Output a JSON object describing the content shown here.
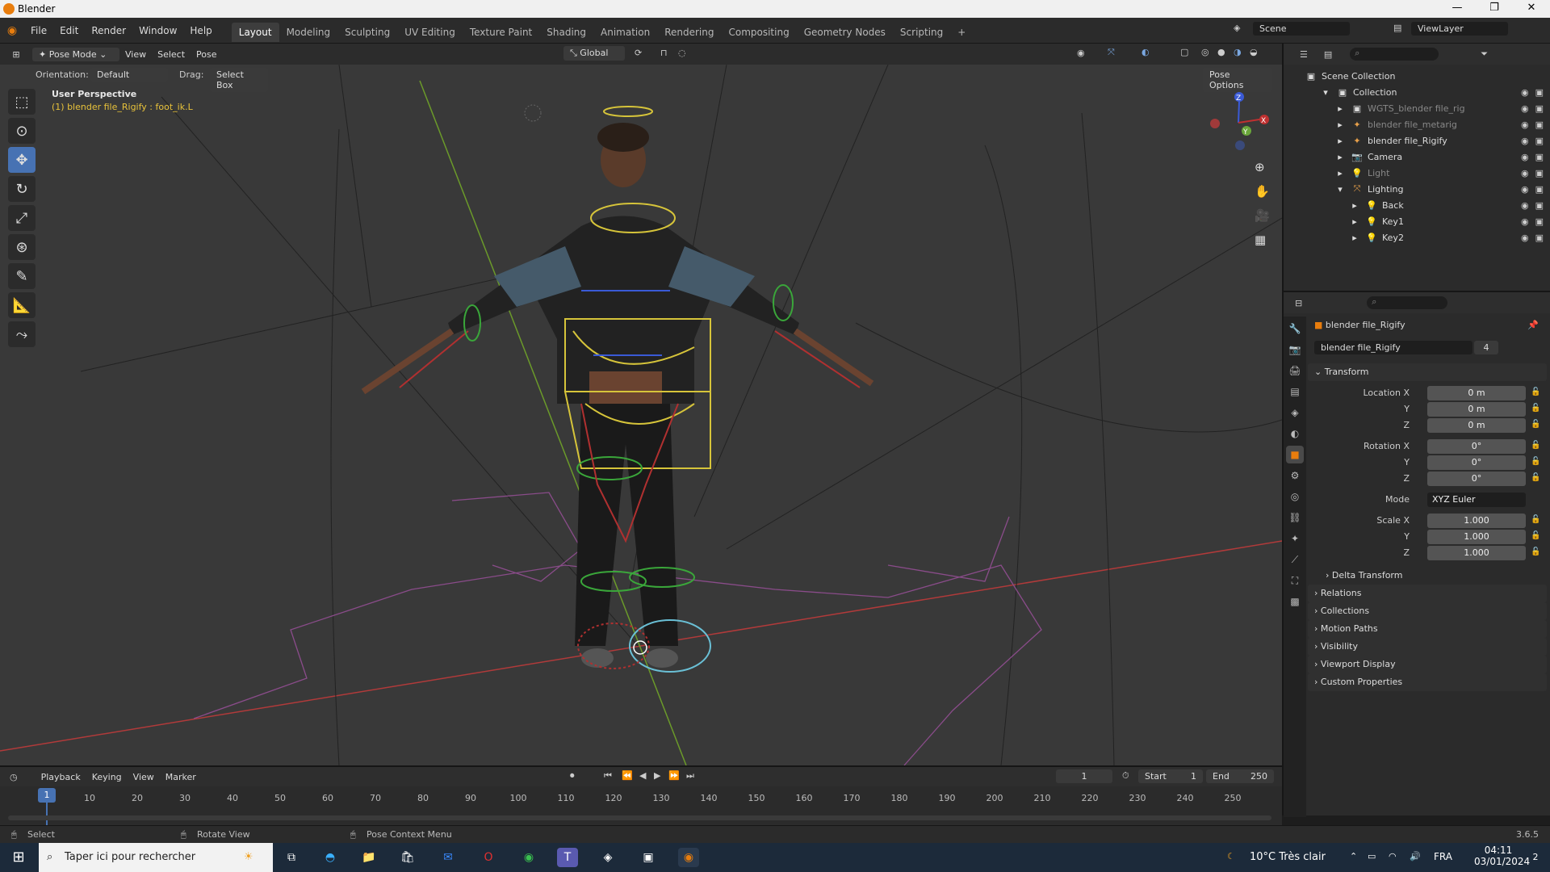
{
  "window": {
    "title": "Blender",
    "controls": [
      "—",
      "❐",
      "✕"
    ]
  },
  "menu": [
    "File",
    "Edit",
    "Render",
    "Window",
    "Help"
  ],
  "workspaces": [
    "Layout",
    "Modeling",
    "Sculpting",
    "UV Editing",
    "Texture Paint",
    "Shading",
    "Animation",
    "Rendering",
    "Compositing",
    "Geometry Nodes",
    "Scripting"
  ],
  "active_workspace": "Layout",
  "add_workspace": "+",
  "scene_name": "Scene",
  "view_layer": "ViewLayer",
  "viewport_header": {
    "mode": "Pose Mode",
    "menus": [
      "View",
      "Select",
      "Pose"
    ],
    "transform_orientation": "Global",
    "orientation_label": "Orientation:",
    "orientation_value": "Default",
    "drag_label": "Drag:",
    "drag_value": "Select Box",
    "pose_options": "Pose Options"
  },
  "viewport": {
    "perspective": "User Perspective",
    "active_info": "(1) blender file_Rigify : foot_ik.L",
    "gizmo_axes": {
      "x": "X",
      "y": "Y",
      "z": "Z"
    }
  },
  "outliner": {
    "root": "Scene Collection",
    "items": [
      {
        "label": "Collection",
        "depth": 1,
        "icon": "collection-icon",
        "expanded": true
      },
      {
        "label": "WGTS_blender file_rig",
        "depth": 2,
        "icon": "collection-icon",
        "dim": true
      },
      {
        "label": "blender file_metarig",
        "depth": 2,
        "icon": "armature-icon",
        "dim": true
      },
      {
        "label": "blender file_Rigify",
        "depth": 2,
        "icon": "armature-icon"
      },
      {
        "label": "Camera",
        "depth": 2,
        "icon": "camera-icon"
      },
      {
        "label": "Light",
        "depth": 2,
        "icon": "light-icon",
        "dim": true
      },
      {
        "label": "Lighting",
        "depth": 2,
        "icon": "empty-icon",
        "expanded": true
      },
      {
        "label": "Back",
        "depth": 3,
        "icon": "light-icon"
      },
      {
        "label": "Key1",
        "depth": 3,
        "icon": "light-icon"
      },
      {
        "label": "Key2",
        "depth": 3,
        "icon": "light-icon"
      }
    ]
  },
  "properties": {
    "object_name": "blender file_Rigify",
    "data_name": "blender file_Rigify",
    "users": "4",
    "transform_label": "Transform",
    "location": {
      "label": "Location X",
      "x": "0 m",
      "y": "0 m",
      "z": "0 m"
    },
    "rotation": {
      "label": "Rotation X",
      "x": "0°",
      "y": "0°",
      "z": "0°"
    },
    "mode_label": "Mode",
    "mode_value": "XYZ Euler",
    "scale": {
      "label": "Scale X",
      "x": "1.000",
      "y": "1.000",
      "z": "1.000"
    },
    "axis_y": "Y",
    "axis_z": "Z",
    "panels": [
      "Delta Transform",
      "Relations",
      "Collections",
      "Motion Paths",
      "Visibility",
      "Viewport Display",
      "Custom Properties"
    ]
  },
  "timeline": {
    "menus": [
      "Playback",
      "Keying",
      "View",
      "Marker"
    ],
    "current_frame": "1",
    "start_label": "Start",
    "start": "1",
    "end_label": "End",
    "end": "250",
    "ticks": [
      "10",
      "20",
      "30",
      "40",
      "50",
      "60",
      "70",
      "80",
      "90",
      "100",
      "110",
      "120",
      "130",
      "140",
      "150",
      "160",
      "170",
      "180",
      "190",
      "200",
      "210",
      "220",
      "230",
      "240",
      "250"
    ]
  },
  "status": {
    "left": "Select",
    "mid": "Rotate View",
    "right": "Pose Context Menu",
    "version": "3.6.5"
  },
  "taskbar": {
    "search_placeholder": "Taper ici pour rechercher",
    "weather": "10°C  Très clair",
    "lang": "FRA",
    "time": "04:11",
    "date": "03/01/2024",
    "notif_count": "2"
  }
}
